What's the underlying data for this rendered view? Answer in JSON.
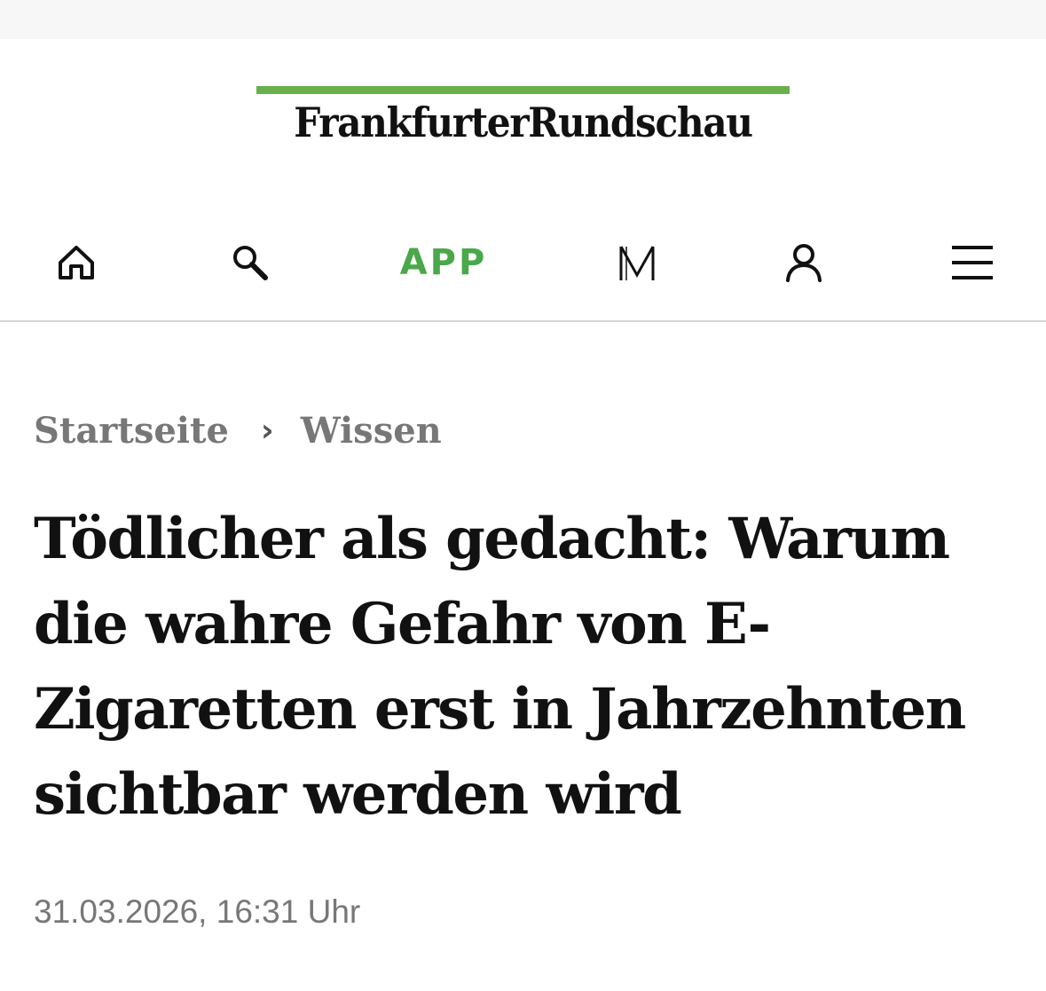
{
  "brand": {
    "logo_text": "FrankfurterRundschau",
    "accent_color": "#6ab04c"
  },
  "nav": {
    "items": [
      {
        "name": "home",
        "icon": "home-icon"
      },
      {
        "name": "search",
        "icon": "search-icon"
      },
      {
        "name": "app",
        "label": "APP",
        "color": "#4aa84a"
      },
      {
        "name": "merkliste",
        "icon": "m-icon"
      },
      {
        "name": "account",
        "icon": "user-icon"
      },
      {
        "name": "menu",
        "icon": "menu-icon"
      }
    ]
  },
  "breadcrumb": {
    "items": [
      "Startseite",
      "Wissen"
    ],
    "separator": "›"
  },
  "article": {
    "headline": "Tödlicher als gedacht: Warum die wahre Gefahr von E-Zigaretten erst in Jahrzehnten sichtbar werden wird",
    "date": "31.03.2026, 16:31 Uhr"
  }
}
